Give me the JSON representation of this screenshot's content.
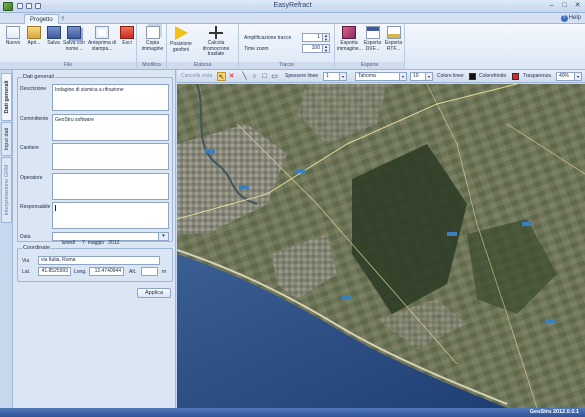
{
  "window": {
    "title": "EasyRefract"
  },
  "tabs": [
    {
      "label": "Progetto"
    },
    {
      "label": "?"
    }
  ],
  "help": {
    "label": "Help"
  },
  "ribbon": {
    "file": {
      "label": "File",
      "buttons": [
        {
          "label": "Nuovo"
        },
        {
          "label": "Apri..."
        },
        {
          "label": "Salva"
        },
        {
          "label": "Salva con nome..."
        },
        {
          "label": "Anteprima di stampa..."
        },
        {
          "label": "Esci"
        }
      ]
    },
    "modifica": {
      "label": "Modifica",
      "buttons": [
        {
          "label": "Copia immagine"
        }
      ]
    },
    "elabora": {
      "label": "Elabora",
      "buttons": [
        {
          "label": "Posizione geofoni"
        },
        {
          "label": "Calcola dromocrone traslate"
        }
      ]
    },
    "tracce": {
      "label": "Tracce",
      "amplificazione_label": "Amplificazione tracce",
      "amplificazione_value": "1",
      "zoom_label": "Time zoom",
      "zoom_value": "100"
    },
    "esporta": {
      "label": "Esporta",
      "buttons": [
        {
          "label": "Esporta immagine..."
        },
        {
          "label": "Esporta DXF..."
        },
        {
          "label": "Esporta RTF..."
        }
      ]
    }
  },
  "side_tabs": [
    {
      "label": "Dati generali",
      "active": true
    },
    {
      "label": "Input dati",
      "active": false
    },
    {
      "label": "Interpretazione GRM",
      "active": false
    }
  ],
  "form": {
    "dati_generali_title": "Dati generali",
    "descrizione_label": "Descrizione",
    "descrizione_value": "Indagine di sismica a rifrazione",
    "committente_label": "Committente",
    "committente_value": "GeoStru software",
    "cantiere_label": "Cantiere",
    "cantiere_value": "",
    "operatore_label": "Operatore",
    "operatore_value": "",
    "responsabile_label": "Responsabile",
    "responsabile_value": "",
    "data_label": "Data",
    "data_value": "lunedì     7  maggio   2012",
    "coordinate_title": "Coordinate",
    "via_label": "Via",
    "via_value": "via Italia, Roma",
    "lat_label": "Lat.",
    "lat_value": "41.8525993",
    "long_label": "Long.",
    "long_value": "12.4740944",
    "alt_label": "Alt.",
    "alt_value": "",
    "alt_unit": "m",
    "apply_label": "Applica"
  },
  "map_toolbar": {
    "cancella_label": "Cancella vista",
    "spessore_label": "Spessore linee",
    "spessore_value": "1",
    "font_value": "Tahoma",
    "font_size_value": "10",
    "colore_linee_label": "Colore linee",
    "colore_linee": "#111111",
    "colore_fondo_label": "Colorefondo",
    "colore_fondo": "#e0202a",
    "trasparenza_label": "Trasparenza",
    "trasparenza_value": "40%"
  },
  "status": {
    "version": "GeoStru 2012.0.0.1"
  }
}
